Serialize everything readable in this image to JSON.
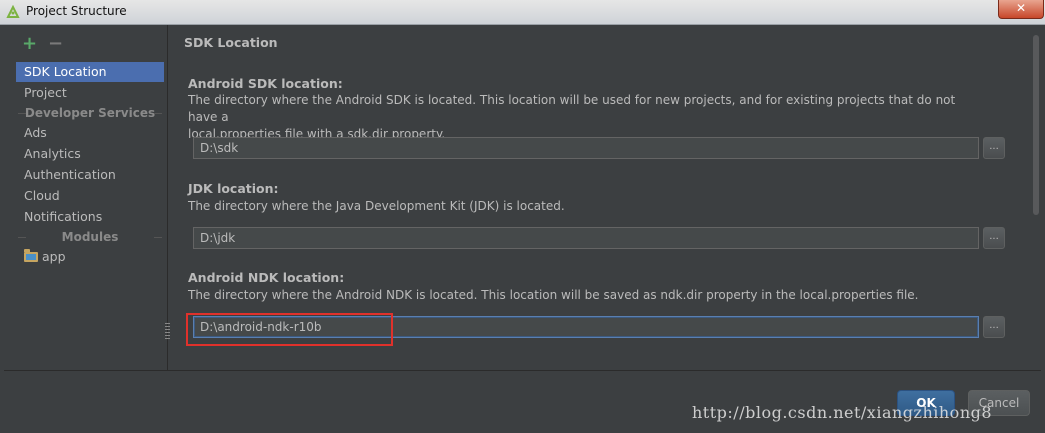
{
  "window": {
    "title": "Project Structure",
    "close_label": "✕"
  },
  "sidebar": {
    "add_label": "+",
    "remove_label": "−",
    "items": [
      {
        "label": "SDK Location",
        "selected": true
      },
      {
        "label": "Project"
      }
    ],
    "developer_services_header": "Developer Services",
    "services": [
      "Ads",
      "Analytics",
      "Authentication",
      "Cloud",
      "Notifications"
    ],
    "modules_header": "Modules",
    "modules": [
      "app"
    ]
  },
  "content": {
    "section_title": "SDK Location",
    "android_sdk": {
      "label": "Android SDK location:",
      "description_line1": "The directory where the Android SDK is located. This location will be used for new projects, and for existing projects that do not have a",
      "description_line2": "local.properties file with a sdk.dir property.",
      "value": "D:\\sdk",
      "browse_label": "..."
    },
    "jdk": {
      "label": "JDK location:",
      "description": "The directory where the Java Development Kit (JDK) is located.",
      "value": "D:\\jdk",
      "browse_label": "..."
    },
    "android_ndk": {
      "label": "Android NDK location:",
      "description": "The directory where the Android NDK is located. This location will be saved as ndk.dir property in the local.properties file.",
      "value": "D:\\android-ndk-r10b",
      "browse_label": "..."
    }
  },
  "buttons": {
    "ok": "OK",
    "cancel": "Cancel"
  },
  "watermark": "http://blog.csdn.net/xiangzhihong8",
  "colors": {
    "selection": "#4b6eaf",
    "highlight_box": "#e0312b",
    "background": "#3c3f41"
  }
}
